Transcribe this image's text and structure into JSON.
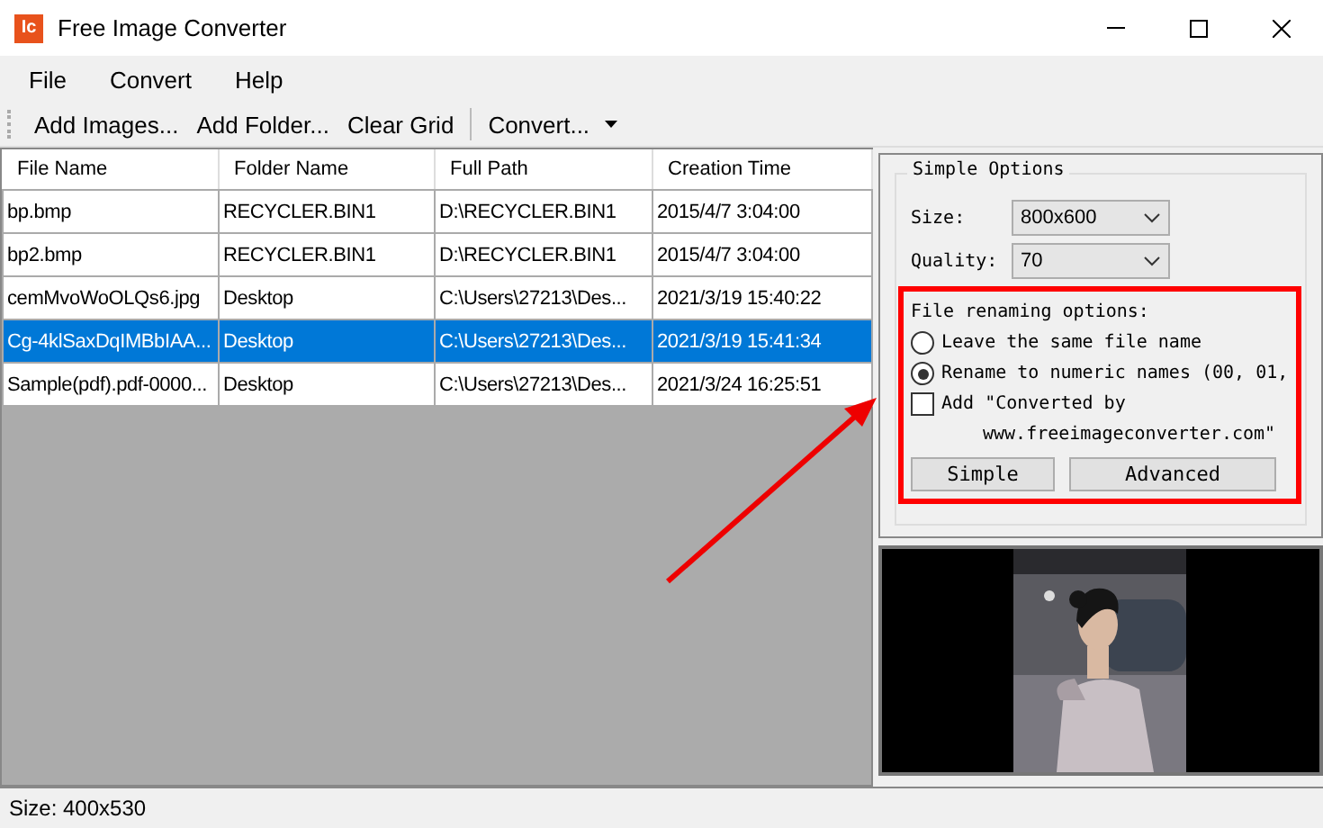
{
  "window": {
    "title": "Free Image Converter",
    "app_icon": "Ic"
  },
  "menu": [
    "File",
    "Convert",
    "Help"
  ],
  "toolbar": [
    {
      "kind": "button",
      "label": "Add Images..."
    },
    {
      "kind": "button",
      "label": "Add Folder..."
    },
    {
      "kind": "button",
      "label": "Clear Grid"
    },
    {
      "kind": "separator"
    },
    {
      "kind": "dropdown",
      "label": "Convert..."
    }
  ],
  "table": {
    "columns": [
      "File Name",
      "Folder Name",
      "Full Path",
      "Creation Time"
    ],
    "rows": [
      {
        "cells": [
          "bp.bmp",
          "RECYCLER.BIN1",
          "D:\\RECYCLER.BIN1",
          "2015/4/7 3:04:00"
        ],
        "selected": false
      },
      {
        "cells": [
          "bp2.bmp",
          "RECYCLER.BIN1",
          "D:\\RECYCLER.BIN1",
          "2015/4/7 3:04:00"
        ],
        "selected": false
      },
      {
        "cells": [
          "cemMvoWoOLQs6.jpg",
          "Desktop",
          "C:\\Users\\27213\\Des...",
          "2021/3/19 15:40:22"
        ],
        "selected": false
      },
      {
        "cells": [
          "Cg-4klSaxDqIMBbIAA...",
          "Desktop",
          "C:\\Users\\27213\\Des...",
          "2021/3/19 15:41:34"
        ],
        "selected": true
      },
      {
        "cells": [
          "Sample(pdf).pdf-0000...",
          "Desktop",
          "C:\\Users\\27213\\Des...",
          "2021/3/24 16:25:51"
        ],
        "selected": false
      }
    ]
  },
  "options": {
    "title": "Simple Options",
    "size": {
      "label": "Size:",
      "value": "800x600"
    },
    "quality": {
      "label": "Quality:",
      "value": "70"
    },
    "renaming": {
      "title": "File renaming options:",
      "choices": [
        {
          "label": "Leave the same file name",
          "selected": false
        },
        {
          "label": "Rename to numeric names (00, 01,",
          "selected": true
        }
      ],
      "add_credit": {
        "label_line1": "Add \"Converted by",
        "label_line2": "www.freeimageconverter.com\"",
        "checked": false
      }
    },
    "buttons": [
      "Simple",
      "Advanced"
    ]
  },
  "preview": {
    "kind": "picture"
  },
  "status_bar": "Size: 400x530"
}
